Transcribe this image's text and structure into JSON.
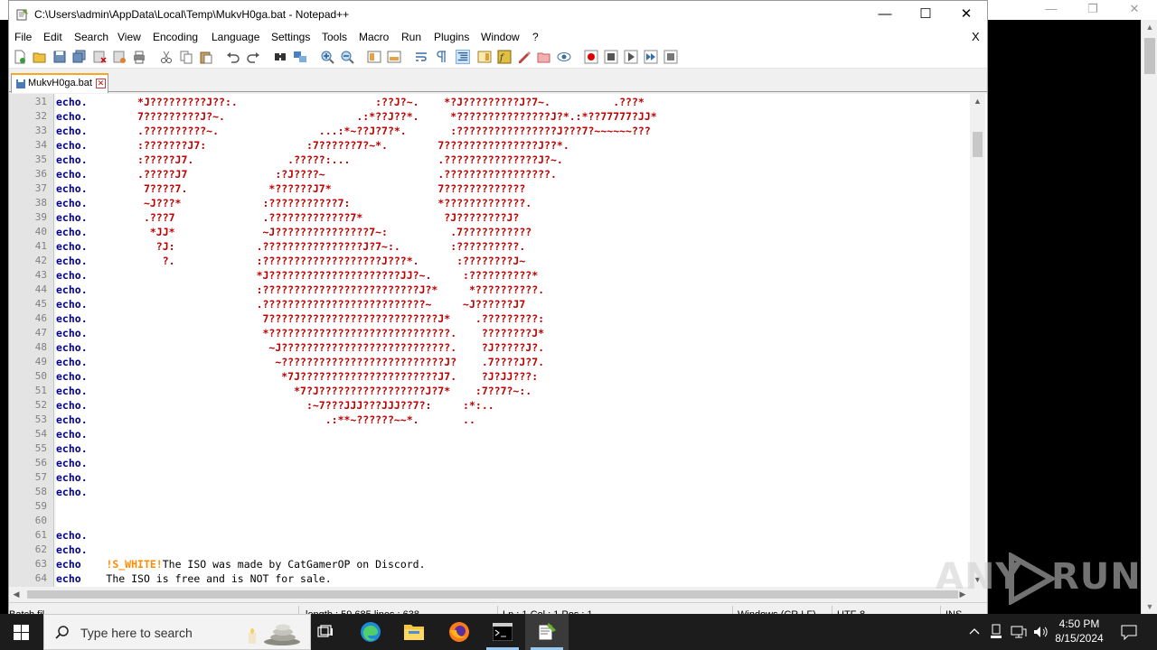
{
  "window": {
    "title": "C:\\Users\\admin\\AppData\\Local\\Temp\\MukvH0ga.bat - Notepad++",
    "minimize_icon": "minimize-icon",
    "maximize_icon": "maximize-icon",
    "close_icon": "close-icon"
  },
  "menu": [
    "File",
    "Edit",
    "Search",
    "View",
    "Encoding",
    "Language",
    "Settings",
    "Tools",
    "Macro",
    "Run",
    "Plugins",
    "Window",
    "?"
  ],
  "menu_close": "X",
  "tab": {
    "label": "MukvH0ga.bat"
  },
  "lines": [
    {
      "n": "31",
      "kw": "echo.",
      "sp": "        ",
      "art": "*J?????????J??:.                      :??J?~.    *?J?????????J?7~.          .???*"
    },
    {
      "n": "32",
      "kw": "echo.",
      "sp": "        ",
      "art": "7?????????J?~.                     .:*??J??*.     *???????????????J?*.:*??77777?JJ*"
    },
    {
      "n": "33",
      "kw": "echo.",
      "sp": "        ",
      "art": ".??????????~.                ...:*~??J?7?*.       :????????????????J???7?~~~~~~???"
    },
    {
      "n": "34",
      "kw": "echo.",
      "sp": "        ",
      "art": ":???????J7:                :7??????7?~*.        7???????????????J??*."
    },
    {
      "n": "35",
      "kw": "echo.",
      "sp": "        ",
      "art": ":?????J7.               .?????:...              .???????????????J?~."
    },
    {
      "n": "36",
      "kw": "echo.",
      "sp": "        ",
      "art": ".?????J7              :?J????~                  .?????????????????."
    },
    {
      "n": "37",
      "kw": "echo.",
      "sp": "        ",
      "art": " 7????7.             *??????J7*                 7?????????????"
    },
    {
      "n": "38",
      "kw": "echo.",
      "sp": "        ",
      "art": " ~J???*             :???????????7:              *?????????????."
    },
    {
      "n": "39",
      "kw": "echo.",
      "sp": "        ",
      "art": " .???7              .?????????????7*             ?J????????J?"
    },
    {
      "n": "40",
      "kw": "echo.",
      "sp": "        ",
      "art": "  *JJ*              ~J???????????????7~:          .7???????????"
    },
    {
      "n": "41",
      "kw": "echo.",
      "sp": "        ",
      "art": "   ?J:             .????????????????J?7~:.        :??????????."
    },
    {
      "n": "42",
      "kw": "echo.",
      "sp": "        ",
      "art": "    ?.             :???????????????????J???*.      :????????J~"
    },
    {
      "n": "43",
      "kw": "echo.",
      "sp": "        ",
      "art": "                   *J?????????????????????JJ?~.     :??????????*"
    },
    {
      "n": "44",
      "kw": "echo.",
      "sp": "        ",
      "art": "                   :?????????????????????????J?*     *??????????."
    },
    {
      "n": "45",
      "kw": "echo.",
      "sp": "        ",
      "art": "                   .??????????????????????????~     ~J??????J7"
    },
    {
      "n": "46",
      "kw": "echo.",
      "sp": "        ",
      "art": "                    7???????????????????????????J*    .?????????:"
    },
    {
      "n": "47",
      "kw": "echo.",
      "sp": "        ",
      "art": "                    *?????????????????????????????.    ????????J*"
    },
    {
      "n": "48",
      "kw": "echo.",
      "sp": "        ",
      "art": "                     ~J???????????????????????????.    ?J?????J?."
    },
    {
      "n": "49",
      "kw": "echo.",
      "sp": "        ",
      "art": "                      ~??????????????????????????J?    .7????J?7."
    },
    {
      "n": "50",
      "kw": "echo.",
      "sp": "        ",
      "art": "                       *7J??????????????????????J7.    ?J?JJ???:"
    },
    {
      "n": "51",
      "kw": "echo.",
      "sp": "        ",
      "art": "                         *7?J?????????????????J?7*    :7??7?~:."
    },
    {
      "n": "52",
      "kw": "echo.",
      "sp": "        ",
      "art": "                           :~7???JJJ???JJJ??7?:     :*:.."
    },
    {
      "n": "53",
      "kw": "echo.",
      "sp": "        ",
      "art": "                              .:**~??????~~*.       .."
    },
    {
      "n": "54",
      "kw": "echo.",
      "sp": "",
      "art": ""
    },
    {
      "n": "55",
      "kw": "echo.",
      "sp": "",
      "art": ""
    },
    {
      "n": "56",
      "kw": "echo.",
      "sp": "",
      "art": ""
    },
    {
      "n": "57",
      "kw": "echo.",
      "sp": "",
      "art": ""
    },
    {
      "n": "58",
      "kw": "echo.",
      "sp": "",
      "art": ""
    },
    {
      "n": "59",
      "kw": "",
      "sp": "",
      "art": ""
    },
    {
      "n": "60",
      "kw": "",
      "sp": "",
      "art": ""
    },
    {
      "n": "61",
      "kw": "echo.",
      "sp": "",
      "art": ""
    },
    {
      "n": "62",
      "kw": "echo.",
      "sp": "",
      "art": ""
    },
    {
      "n": "63",
      "kw": "echo",
      "sp": "    ",
      "var": "!S_WHITE!",
      "pl": "The ISO was made by CatGamerOP on Discord."
    },
    {
      "n": "64",
      "kw": "echo",
      "sp": "    ",
      "pl": "The ISO is free and is NOT for sale."
    }
  ],
  "status": {
    "type": "Batch fil",
    "length": "length : 59,685    lines : 638",
    "pos": "Ln : 1    Col : 1    Pos : 1",
    "eol": "Windows (CR LF)",
    "enc": "UTF-8",
    "ins": "INS"
  },
  "watermark": {
    "any": "ANY",
    "run": "RUN"
  },
  "taskbar": {
    "search_placeholder": "Type here to search",
    "time": "4:50 PM",
    "date": "8/15/2024"
  },
  "colors": {
    "keyword": "#00008b",
    "art": "#c00000",
    "variable": "#ff8c00",
    "tab_accent": "#f8a81c"
  }
}
